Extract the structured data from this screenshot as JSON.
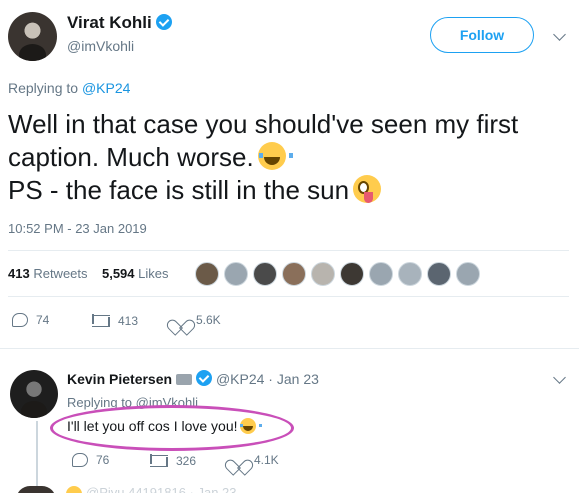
{
  "tweet": {
    "author_name": "Virat Kohli",
    "author_handle": "@imVkohli",
    "follow_label": "Follow",
    "replying_prefix": "Replying to",
    "replying_handle": "@KP24",
    "text_line1": "Well in that case you should've seen my first caption. Much worse.",
    "text_line2": "PS - the face is still in the sun",
    "emoji_1": "face-with-tears-of-joy",
    "emoji_2": "zany-face",
    "timestamp": "10:52 PM - 23 Jan 2019",
    "retweets_count": "413",
    "retweets_label": "Retweets",
    "likes_count": "5,594",
    "likes_label": "Likes",
    "liker_avatar_count": 10,
    "actions": {
      "replies": "74",
      "retweets": "413",
      "likes": "5.6K"
    }
  },
  "reply": {
    "author_name": "Kevin Pietersen",
    "author_handle": "@KP24",
    "date": "Jan 23",
    "replying_label": "Replying to @imVkohli",
    "text": "I'll let you off cos I love you!",
    "emoji": "face-with-tears-of-joy",
    "actions": {
      "replies": "76",
      "retweets": "326",
      "likes": "4.1K"
    },
    "highlight_color": "#c94fb9"
  },
  "next_reply_partial": "@Piyu 44191816 · Jan 23",
  "colors": {
    "accent": "#1da1f2",
    "secondary_text": "#657786",
    "divider": "#e6ecf0"
  },
  "icons": [
    "verified-badge-icon",
    "chevron-down-icon",
    "reply-icon",
    "retweet-icon",
    "like-icon"
  ]
}
